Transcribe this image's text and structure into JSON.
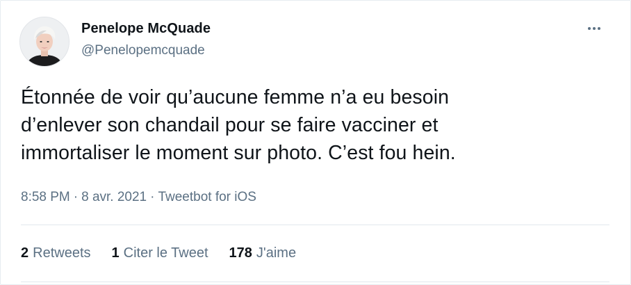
{
  "author": {
    "display_name": "Penelope McQuade",
    "handle": "@Penelopemcquade",
    "avatar_icon": "profile-photo"
  },
  "tweet": {
    "text": "Étonnée de voir qu’aucune femme n’a eu besoin\nd’enlever son chandail pour se faire vacciner et\nimmortaliser le moment sur photo. C’est fou hein."
  },
  "meta": {
    "time": "8:58 PM",
    "separator": "·",
    "date": "8 avr. 2021",
    "client": "Tweetbot for iOS"
  },
  "stats": {
    "retweets": {
      "count": "2",
      "label": "Retweets"
    },
    "quotes": {
      "count": "1",
      "label": "Citer le Tweet"
    },
    "likes": {
      "count": "178",
      "label": "J'aime"
    }
  },
  "colors": {
    "text_primary": "#0f1419",
    "text_secondary": "#5b7083",
    "divider": "#e1e8ed"
  }
}
